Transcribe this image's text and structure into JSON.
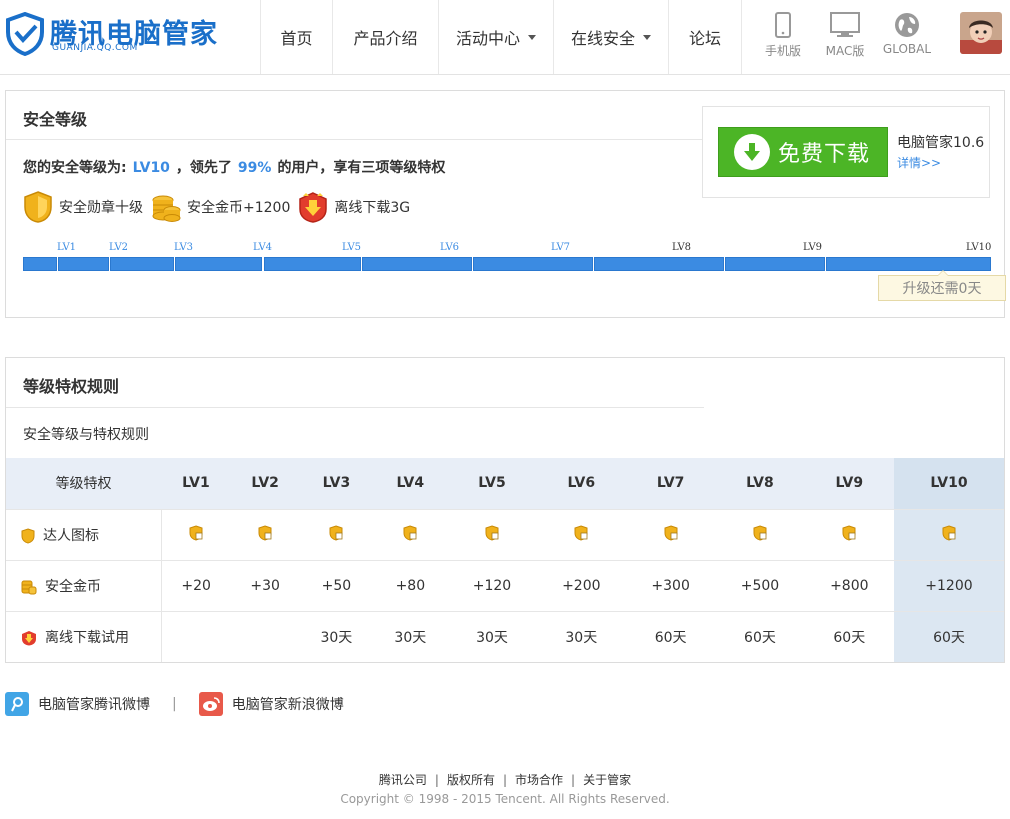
{
  "header": {
    "logo_title": "腾讯电脑管家",
    "logo_sub": "GUANJIA.QQ.COM",
    "nav": [
      {
        "label": "首页"
      },
      {
        "label": "产品介绍"
      },
      {
        "label": "活动中心"
      },
      {
        "label": "在线安全"
      },
      {
        "label": "论坛"
      }
    ],
    "platforms": [
      {
        "label": "手机版",
        "icon": "phone-icon"
      },
      {
        "label": "MAC版",
        "icon": "monitor-icon"
      },
      {
        "label": "GLOBAL",
        "icon": "globe-icon"
      }
    ],
    "avatar": "user-avatar"
  },
  "level_panel": {
    "title": "安全等级",
    "prefix": "您的安全等级为:",
    "level": "LV10",
    "mid": "，领先了",
    "percent": "99%",
    "suffix": "的用户，享有三项等级特权",
    "privileges": [
      {
        "label": "安全勋章十级",
        "icon": "medal-icon"
      },
      {
        "label": "安全金币+1200",
        "icon": "coins-icon"
      },
      {
        "label": "离线下载3G",
        "icon": "offline-download-icon"
      }
    ],
    "levels": [
      "LV1",
      "LV2",
      "LV3",
      "LV4",
      "LV5",
      "LV6",
      "LV7",
      "LV8",
      "LV9",
      "LV10"
    ],
    "tip": "升级还需0天",
    "download": {
      "button": "免费下载",
      "version": "电脑管家10.6",
      "more": "详情>>"
    }
  },
  "rules_panel": {
    "title": "等级特权规则",
    "subtitle": "安全等级与特权规则",
    "header_first": "等级特权",
    "levels": [
      "LV1",
      "LV2",
      "LV3",
      "LV4",
      "LV5",
      "LV6",
      "LV7",
      "LV8",
      "LV9",
      "LV10"
    ],
    "rows": {
      "badge": {
        "label": "达人图标"
      },
      "coins": {
        "label": "安全金币",
        "values": [
          "+20",
          "+30",
          "+50",
          "+80",
          "+120",
          "+200",
          "+300",
          "+500",
          "+800",
          "+1200"
        ]
      },
      "offline": {
        "label": "离线下载试用",
        "values": [
          "",
          "",
          "30天",
          "30天",
          "30天",
          "30天",
          "60天",
          "60天",
          "60天",
          "60天"
        ]
      }
    }
  },
  "social": {
    "tencent_weibo": "电脑管家腾讯微博",
    "separator": "|",
    "sina_weibo": "电脑管家新浪微博"
  },
  "footer": {
    "links": [
      "腾讯公司",
      "版权所有",
      "市场合作",
      "关于管家"
    ],
    "copyright": "Copyright © 1998 - 2015 Tencent. All Rights Reserved."
  },
  "colors": {
    "brand_blue": "#3b8be2",
    "download_green": "#4cb526",
    "highlight_col": "#dce7f2"
  }
}
